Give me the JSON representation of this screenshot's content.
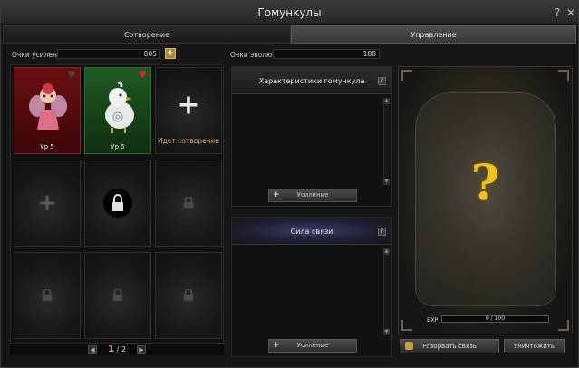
{
  "window": {
    "title": "Гомункулы",
    "help_icon": "?",
    "close_icon": "✕"
  },
  "tabs": [
    {
      "label": "Сотворение"
    },
    {
      "label": "Управление"
    }
  ],
  "stats": {
    "enhance_points_label": "Очки усиления",
    "enhance_points_value": "805",
    "evolution_points_label": "Очки эволюции",
    "evolution_points_value": "188"
  },
  "homunculi": [
    {
      "level": "Ур 5",
      "bg": "red",
      "favorite": false
    },
    {
      "level": "Ур 5",
      "bg": "green",
      "favorite": true
    }
  ],
  "creating_slot": {
    "label": "Идет сотворение"
  },
  "pager": {
    "current": "1",
    "total": "/ 2"
  },
  "characteristics": {
    "title": "Характеристики гомункула",
    "button": "Усиление"
  },
  "bond": {
    "title": "Сила связи",
    "button": "Усиление"
  },
  "preview": {
    "exp_label": "EXP",
    "exp_value": "0 / 100",
    "symbol": "?"
  },
  "actions": {
    "break_bond": "Разорвать связь",
    "destroy": "Уничтожить"
  },
  "colors": {
    "accent": "#f0c020",
    "heart": "#e02020",
    "red_slot": "#6a0f12",
    "green_slot": "#1e5a22"
  }
}
